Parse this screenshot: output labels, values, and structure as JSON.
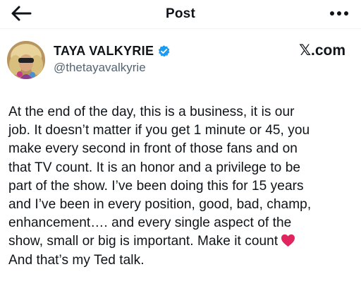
{
  "header": {
    "title": "Post",
    "back_icon": "arrow-left-icon",
    "more_icon": "more-horizontal-icon"
  },
  "author": {
    "display_name": "TAYA VALKYRIE",
    "handle": "@thetayavalkyrie",
    "verified_icon": "verified-badge-icon",
    "verified_color": "#1d9bf0",
    "avatar": "avatar"
  },
  "brand": {
    "mark": "𝕏",
    "suffix": ".com"
  },
  "tweet": {
    "text": "At the end of the day, this is a business, it is our\njob. It doesn’t matter if you get 1 minute or 45, you\nmake every second in front of those fans and on\nthat TV count. It is an honor and a privilege to be\npart of the show. I’ve been doing this for 15 years\nand I’ve been in every position, good, bad, champ,\nenhancement…. and every single aspect of the\nshow, small or big is important. Make it count",
    "after_emoji_text": "And that’s my Ted talk.",
    "emoji_icon": "red-heart-icon",
    "emoji_color": "#e0245e"
  }
}
